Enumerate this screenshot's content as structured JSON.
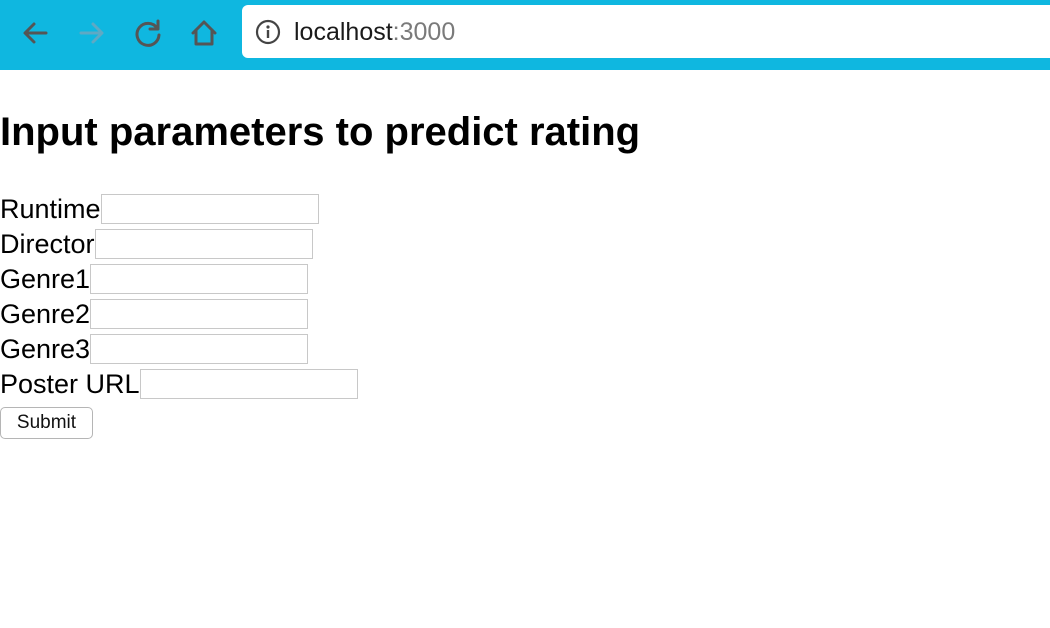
{
  "browser": {
    "url_host": "localhost",
    "url_port": ":3000",
    "bar_color": "#0fb7e0"
  },
  "page": {
    "title": "Input parameters to predict rating",
    "fields": [
      {
        "label": "Runtime",
        "value": ""
      },
      {
        "label": "Director",
        "value": ""
      },
      {
        "label": "Genre1",
        "value": ""
      },
      {
        "label": "Genre2",
        "value": ""
      },
      {
        "label": "Genre3",
        "value": ""
      },
      {
        "label": "Poster URL",
        "value": ""
      }
    ],
    "submit_label": "Submit"
  },
  "icons": {
    "back": "arrow-left-icon",
    "forward": "arrow-right-icon",
    "reload": "reload-icon",
    "home": "home-icon",
    "info": "info-icon"
  }
}
